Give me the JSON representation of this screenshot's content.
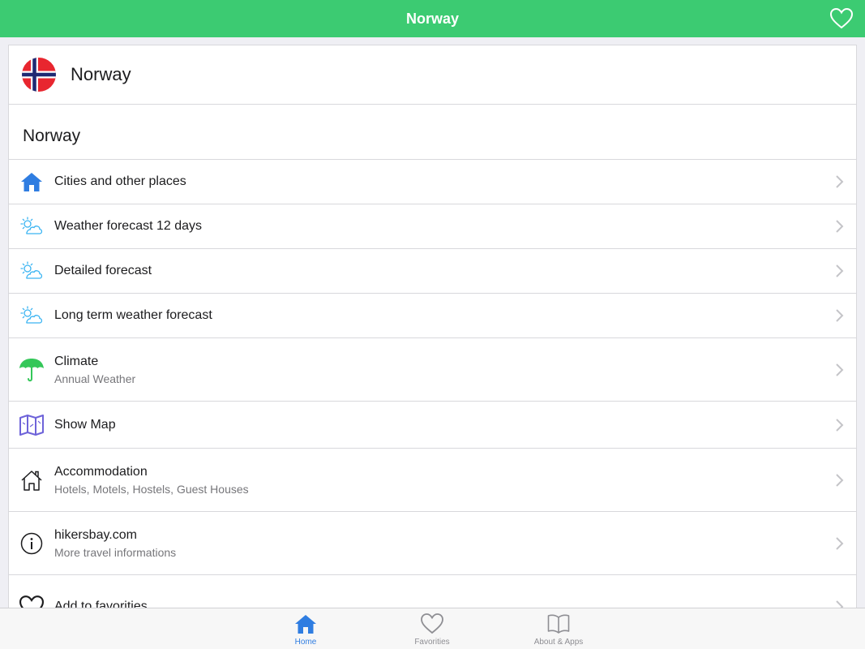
{
  "navbar": {
    "title": "Norway",
    "favorite_icon": "heart-outline-icon"
  },
  "header_card": {
    "flag_icon": "norway-flag-icon",
    "title": "Norway"
  },
  "section": {
    "title": "Norway"
  },
  "menu": [
    {
      "icon": "home-icon",
      "label": "Cities and other places",
      "sub": ""
    },
    {
      "icon": "partly-cloudy-icon",
      "label": "Weather forecast 12 days",
      "sub": ""
    },
    {
      "icon": "partly-cloudy-icon",
      "label": "Detailed forecast",
      "sub": ""
    },
    {
      "icon": "partly-cloudy-icon",
      "label": "Long term weather forecast",
      "sub": ""
    },
    {
      "icon": "umbrella-icon",
      "label": "Climate",
      "sub": "Annual Weather"
    },
    {
      "icon": "map-icon",
      "label": "Show Map",
      "sub": ""
    },
    {
      "icon": "house-outline-icon",
      "label": "Accommodation",
      "sub": "Hotels, Motels, Hostels, Guest Houses"
    },
    {
      "icon": "info-icon",
      "label": "hikersbay.com",
      "sub": "More travel informations"
    },
    {
      "icon": "heart-outline-icon",
      "label": "Add to favorities",
      "sub": ""
    }
  ],
  "tabbar": {
    "tabs": [
      {
        "icon": "home-icon",
        "label": "Home",
        "active": true
      },
      {
        "icon": "heart-outline-icon",
        "label": "Favorities",
        "active": false
      },
      {
        "icon": "book-icon",
        "label": "About & Apps",
        "active": false
      }
    ]
  },
  "colors": {
    "navbar": "#3ccb72",
    "accent_blue": "#2f7de1",
    "weather_icon": "#3ab4f2",
    "umbrella": "#34c759",
    "map": "#6e63d9"
  }
}
